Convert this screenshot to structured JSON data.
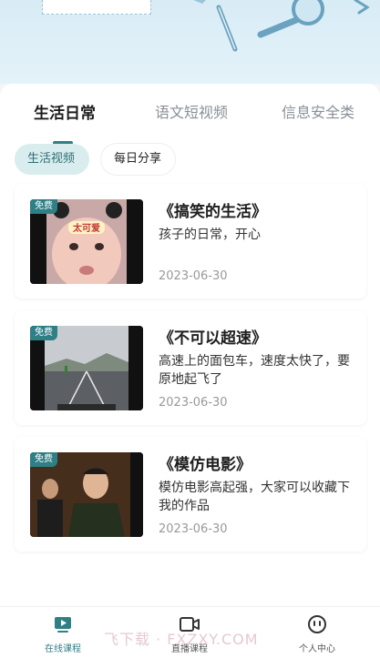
{
  "tabs": [
    {
      "label": "生活日常",
      "active": true
    },
    {
      "label": "语文短视频",
      "active": false
    },
    {
      "label": "信息安全类",
      "active": false
    }
  ],
  "chips": [
    {
      "label": "生活视频",
      "active": true
    },
    {
      "label": "每日分享",
      "active": false
    }
  ],
  "videos": [
    {
      "badge": "免费",
      "title": "《搞笑的生活》",
      "desc": "孩子的日常，开心",
      "date": "2023-06-30",
      "thumb_text": "太可爱"
    },
    {
      "badge": "免费",
      "title": "《不可以超速》",
      "desc": "高速上的面包车，速度太快了，要原地起飞了",
      "date": "2023-06-30"
    },
    {
      "badge": "免费",
      "title": "《模仿电影》",
      "desc": "模仿电影高起强，大家可以收藏下我的作品",
      "date": "2023-06-30"
    }
  ],
  "bottom_nav": [
    {
      "label": "在线课程",
      "icon": "play-screen-icon",
      "active": true
    },
    {
      "label": "直播课程",
      "icon": "video-camera-icon",
      "active": false
    },
    {
      "label": "个人中心",
      "icon": "smiley-face-icon",
      "active": false
    }
  ],
  "watermark": "飞下载 · FXZXY.COM",
  "colors": {
    "accent": "#2f7f86",
    "chip_bg": "#d9ecee",
    "banner": "#d8ecf6"
  }
}
